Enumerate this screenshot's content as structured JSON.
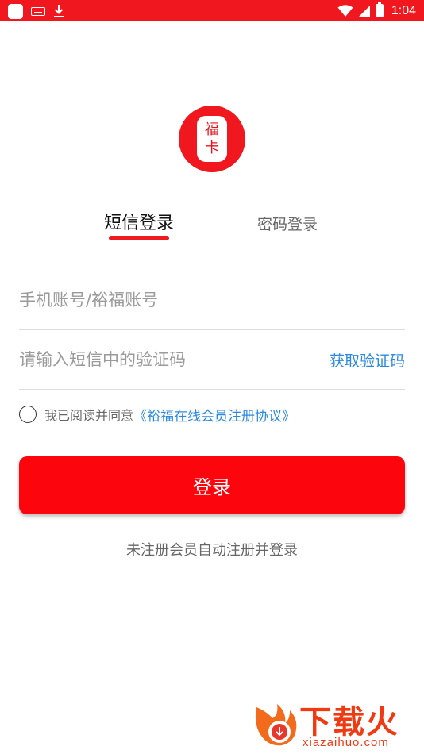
{
  "status_bar": {
    "time": "1:04",
    "icons": [
      "app-icon",
      "keyboard-icon",
      "download-icon",
      "wifi-icon",
      "signal-icon",
      "battery-icon"
    ]
  },
  "logo": {
    "char_top": "福",
    "char_bottom": "卡"
  },
  "tabs": [
    {
      "label": "短信登录",
      "active": true
    },
    {
      "label": "密码登录",
      "active": false
    }
  ],
  "form": {
    "phone_placeholder": "手机账号/裕福账号",
    "code_placeholder": "请输入短信中的验证码",
    "get_code_label": "获取验证码"
  },
  "agreement": {
    "prefix": "我已阅读并同意",
    "link": "《裕福在线会员注册协议》",
    "checked": false
  },
  "login_button": {
    "label": "登录"
  },
  "hint": "未注册会员自动注册并登录",
  "watermark": {
    "title": "下载火",
    "url": "xiazaihuo.com"
  },
  "colors": {
    "brand_red": "#f0171e",
    "link_blue": "#2b8ae0"
  }
}
